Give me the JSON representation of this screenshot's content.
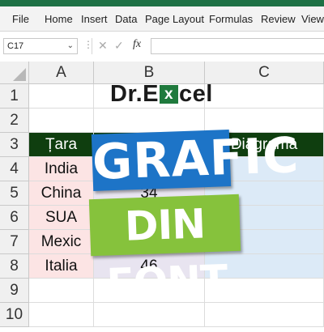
{
  "ribbon": {
    "tabs": [
      "File",
      "Home",
      "Insert",
      "Data",
      "Page Layout",
      "Formulas",
      "Review",
      "View"
    ]
  },
  "formula_bar": {
    "name_box": "C17",
    "fx_label": "fx",
    "formula": ""
  },
  "columns": [
    "A",
    "B",
    "C"
  ],
  "rows": [
    "1",
    "2",
    "3",
    "4",
    "5",
    "6",
    "7",
    "8",
    "9",
    "10"
  ],
  "cells": {
    "A3": "Țara",
    "C3": "Diagrama",
    "A4": "India",
    "A5": "China",
    "B5": "34",
    "A6": "SUA",
    "A7": "Mexic",
    "A8": "Italia",
    "B8": "46"
  },
  "logo": {
    "left": "Dr.E",
    "boxed_letter": "x",
    "right": "cel"
  },
  "overlay": {
    "line1": "GRAFIC",
    "line2": "DIN FONT"
  },
  "colors": {
    "excel_green": "#1e7145",
    "header_fill": "#0f3e0f",
    "banner_blue": "#1d74c7",
    "banner_green": "#86c23c"
  }
}
